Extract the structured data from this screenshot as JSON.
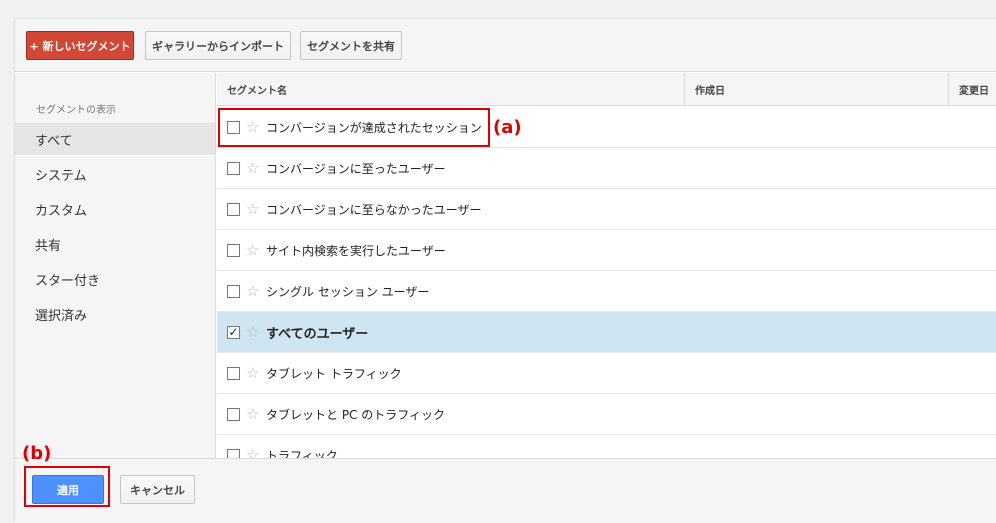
{
  "toolbar": {
    "new_segment": "+ 新しいセグメント",
    "import_gallery": "ギャラリーからインポート",
    "share_segments": "セグメントを共有"
  },
  "sidebar": {
    "heading": "セグメントの表示",
    "items": [
      {
        "label": "すべて",
        "active": true
      },
      {
        "label": "システム"
      },
      {
        "label": "カスタム"
      },
      {
        "label": "共有"
      },
      {
        "label": "スター付き"
      },
      {
        "label": "選択済み"
      }
    ]
  },
  "table": {
    "columns": [
      "セグメント名",
      "作成日",
      "変更日"
    ],
    "rows": [
      {
        "label": "コンバージョンが達成されたセッション",
        "checked": false
      },
      {
        "label": "コンバージョンに至ったユーザー",
        "checked": false
      },
      {
        "label": "コンバージョンに至らなかったユーザー",
        "checked": false
      },
      {
        "label": "サイト内検索を実行したユーザー",
        "checked": false
      },
      {
        "label": "シングル セッション ユーザー",
        "checked": false
      },
      {
        "label": "すべてのユーザー",
        "checked": true
      },
      {
        "label": "タブレット トラフィック",
        "checked": false
      },
      {
        "label": "タブレットと PC のトラフィック",
        "checked": false
      },
      {
        "label": "トラフィック",
        "checked": false
      }
    ]
  },
  "footer": {
    "apply": "適用",
    "cancel": "キャンセル"
  },
  "annotations": {
    "a": "(a)",
    "b": "(b)"
  },
  "colors": {
    "new_segment_button": "#d14836",
    "apply_button": "#4d90fe",
    "selected_row": "#d0e5f2",
    "annotation": "#dd0000"
  }
}
